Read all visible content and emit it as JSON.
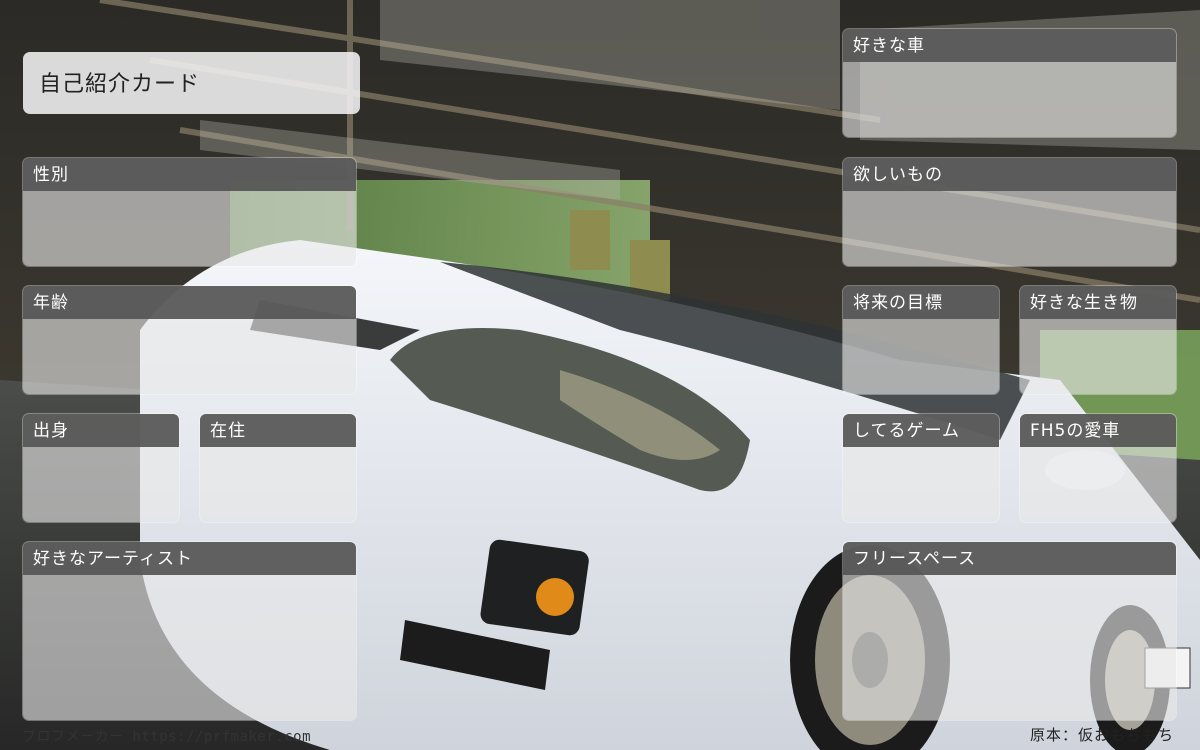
{
  "card": {
    "title": "自己紹介カード"
  },
  "left_fields": {
    "gender": "性別",
    "age": "年齢",
    "hometown": "出身",
    "residence": "在住",
    "favorite_artist": "好きなアーティスト"
  },
  "right_fields": {
    "favorite_car": "好きな車",
    "wanted": "欲しいもの",
    "future_goal": "将来の目標",
    "favorite_creature": "好きな生き物",
    "playing_game": "してるゲーム",
    "fh5_car": "FH5の愛車",
    "free_space": "フリースペース"
  },
  "footer": {
    "maker": "プロフメーカー https://prfmaker.com",
    "credit": "原本：仮おもちもち"
  },
  "colors": {
    "label_bg": "#555555",
    "field_bg": "#e8e8e8",
    "car_body": "#e9ecf2"
  }
}
